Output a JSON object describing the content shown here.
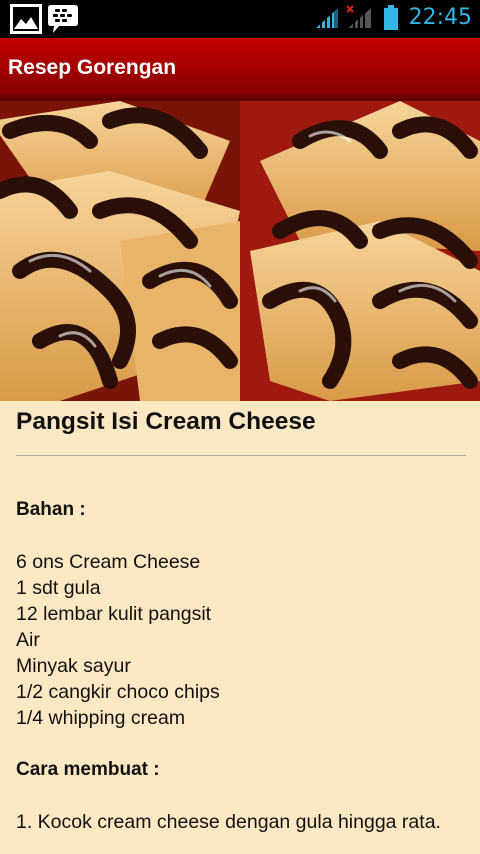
{
  "status_bar": {
    "time": "22:45",
    "icons": [
      "gallery-notification-icon",
      "bbm-notification-icon",
      "wifi-signal-icon",
      "cell-signal-icon",
      "battery-icon"
    ]
  },
  "action_bar": {
    "title": "Resep Gorengan"
  },
  "recipe": {
    "title": "Pangsit Isi Cream Cheese",
    "bahan_label": "Bahan :",
    "ingredients": [
      "6 ons Cream Cheese",
      "1 sdt gula",
      "12 lembar kulit pangsit",
      "Air",
      "Minyak sayur",
      "1/2 cangkir choco chips",
      "1/4 whipping cream"
    ],
    "cara_label": "Cara membuat :",
    "steps": [
      "1. Kocok cream cheese dengan gula hingga rata."
    ]
  },
  "colors": {
    "status_accent": "#33b5e5",
    "action_bar": "#b00000",
    "background": "#fde8c4"
  }
}
